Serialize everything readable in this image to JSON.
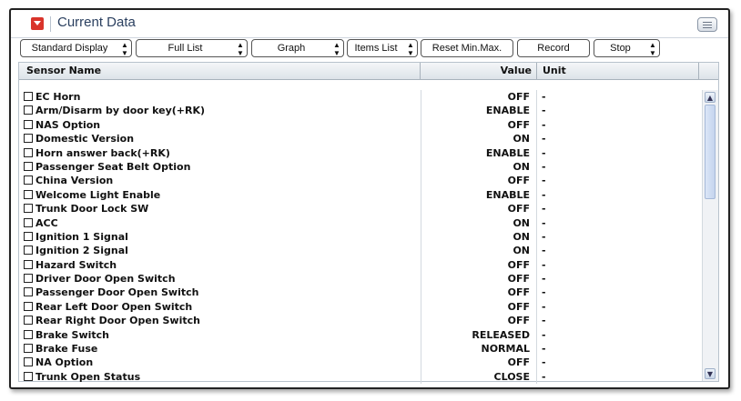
{
  "title": "Current Data",
  "toolbar": {
    "standard_display": "Standard Display",
    "full_list": "Full List",
    "graph": "Graph",
    "items_list": "Items List",
    "reset_minmax": "Reset Min.Max.",
    "record": "Record",
    "stop": "Stop"
  },
  "columns": {
    "sensor_name": "Sensor Name",
    "value": "Value",
    "unit": "Unit"
  },
  "rows": [
    {
      "name": "EC Horn",
      "value": "OFF",
      "unit": "-"
    },
    {
      "name": "Arm/Disarm by door key(+RK)",
      "value": "ENABLE",
      "unit": "-"
    },
    {
      "name": "NAS Option",
      "value": "OFF",
      "unit": "-"
    },
    {
      "name": "Domestic Version",
      "value": "ON",
      "unit": "-"
    },
    {
      "name": "Horn answer back(+RK)",
      "value": "ENABLE",
      "unit": "-"
    },
    {
      "name": "Passenger Seat Belt Option",
      "value": "ON",
      "unit": "-"
    },
    {
      "name": "China Version",
      "value": "OFF",
      "unit": "-"
    },
    {
      "name": "Welcome Light Enable",
      "value": "ENABLE",
      "unit": "-"
    },
    {
      "name": "Trunk Door Lock SW",
      "value": "OFF",
      "unit": "-"
    },
    {
      "name": "ACC",
      "value": "ON",
      "unit": "-"
    },
    {
      "name": "Ignition 1 Signal",
      "value": "ON",
      "unit": "-"
    },
    {
      "name": "Ignition 2 Signal",
      "value": "ON",
      "unit": "-"
    },
    {
      "name": "Hazard Switch",
      "value": "OFF",
      "unit": "-"
    },
    {
      "name": "Driver Door Open Switch",
      "value": "OFF",
      "unit": "-"
    },
    {
      "name": "Passenger Door Open Switch",
      "value": "OFF",
      "unit": "-"
    },
    {
      "name": "Rear Left Door Open Switch",
      "value": "OFF",
      "unit": "-"
    },
    {
      "name": "Rear Right Door Open Switch",
      "value": "OFF",
      "unit": "-"
    },
    {
      "name": "Brake Switch",
      "value": "RELEASED",
      "unit": "-"
    },
    {
      "name": "Brake Fuse",
      "value": "NORMAL",
      "unit": "-"
    },
    {
      "name": "NA Option",
      "value": "OFF",
      "unit": "-"
    },
    {
      "name": "Trunk Open Status",
      "value": "CLOSE",
      "unit": "-"
    }
  ],
  "icons": {
    "collapse": "collapse-icon",
    "menu": "menu-icon",
    "dropdown": "updown-arrows-icon",
    "checkbox": "checkbox-icon",
    "scroll_up": "scroll-up-icon",
    "scroll_down": "scroll-down-icon"
  },
  "colors": {
    "accent_red": "#d9342b",
    "title_text": "#2a3f5f"
  }
}
